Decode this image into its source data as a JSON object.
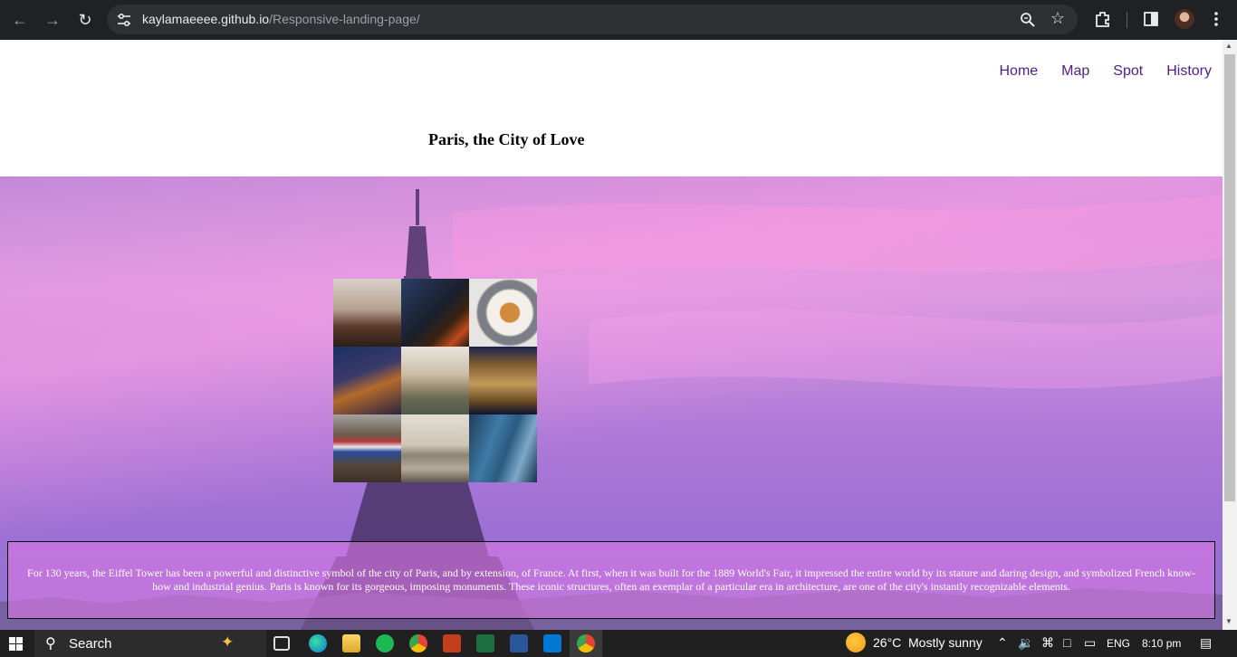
{
  "browser": {
    "url_host": "kaylamaeeee.github.io",
    "url_path": "/Responsive-landing-page/",
    "icons": [
      "back-arrow-icon",
      "forward-arrow-icon",
      "reload-icon",
      "site-settings-icon",
      "zoom-icon",
      "bookmark-star-icon",
      "extensions-icon",
      "side-panel-icon",
      "profile-avatar-icon",
      "more-menu-icon"
    ]
  },
  "page": {
    "nav": [
      "Home",
      "Map",
      "Spot",
      "History"
    ],
    "title": "Paris, the City of Love",
    "collage_count": 9,
    "caption": "For 130 years, the Eiffel Tower has been a powerful and distinctive symbol of the city of Paris, and by extension, of France. At first, when it was built for the 1889 World's Fair, it impressed the entire world by its stature and daring design, and symbolized French know-how and industrial genius. Paris is known for its gorgeous, imposing monuments. These iconic structures, often an exemplar of a particular era in architecture, are one of the city's instantly recognizable elements."
  },
  "taskbar": {
    "search_label": "Search",
    "weather_temp": "26°C",
    "weather_text": "Mostly sunny",
    "language": "ENG",
    "time": "8:10 pm"
  },
  "colors": {
    "nav_link": "#551a8b",
    "chrome_bg": "#202124",
    "taskbar_bg": "#202020"
  }
}
